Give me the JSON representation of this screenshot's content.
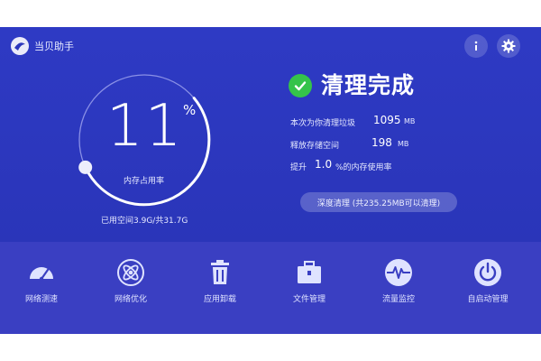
{
  "header": {
    "app_title": "当贝助手"
  },
  "gauge": {
    "value": "11",
    "unit": "%",
    "label": "内存占用率",
    "fraction": 0.11
  },
  "storage": {
    "text": "已用空间3.9G/共31.7G"
  },
  "status": {
    "title": "清理完成"
  },
  "stats": {
    "cleaned": {
      "label": "本次为你清理垃圾",
      "value": "1095",
      "unit": "MB"
    },
    "freed": {
      "label": "释放存储空间",
      "value": "198",
      "unit": "MB"
    },
    "improve": {
      "prefix": "提升",
      "value": "1.0",
      "suffix": "%的内存使用率"
    }
  },
  "deep_clean": {
    "label": "深度清理 (共235.25MB可以清理)"
  },
  "tools": [
    {
      "label": "网络测速",
      "icon": "speedometer-icon"
    },
    {
      "label": "网络优化",
      "icon": "atom-icon"
    },
    {
      "label": "应用卸载",
      "icon": "trash-icon"
    },
    {
      "label": "文件管理",
      "icon": "briefcase-icon"
    },
    {
      "label": "流量监控",
      "icon": "pulse-icon"
    },
    {
      "label": "自启动管理",
      "icon": "power-icon"
    }
  ],
  "colors": {
    "background": "#2b36bb",
    "bottom_bar": "#3a3fc2",
    "success": "#35c34a"
  }
}
